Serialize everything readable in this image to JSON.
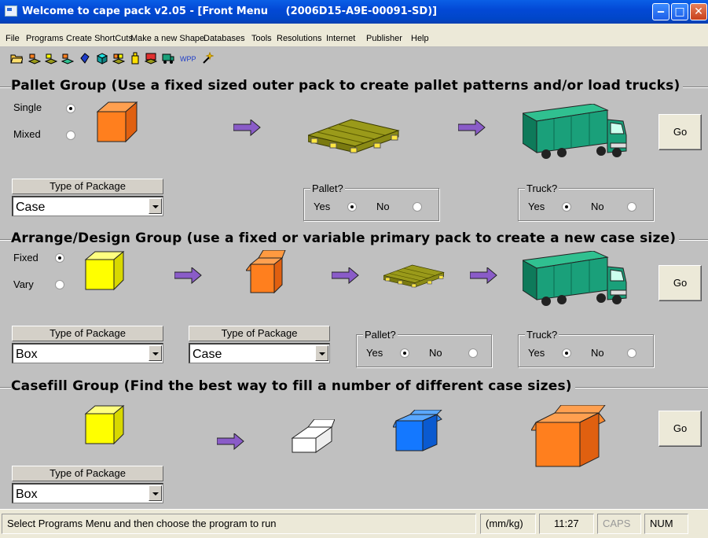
{
  "window": {
    "title": "Welcome to cape pack v2.05 - [Front Menu     (2006D15-A9E-00091-SD)]",
    "buttons": [
      "minimize-icon",
      "maximize-icon",
      "close-icon"
    ]
  },
  "menu": [
    "File",
    "Programs",
    "Create ShortCuts",
    "Make a new Shape",
    "Databases",
    "Tools",
    "Resolutions",
    "Internet",
    "Publisher",
    "Help"
  ],
  "toolbar": {
    "icons": [
      "open-folder-icon",
      "pallet-tool-icon",
      "arrange-tool-icon",
      "design-tool-icon",
      "casefill-tool-icon",
      "cube-tool-icon",
      "mixed-tool-icon",
      "bottle-tool-icon",
      "pallet-view-icon",
      "truck-tool-icon",
      "wpp-icon",
      "wand-icon"
    ],
    "wpp_label": "WPP"
  },
  "pallet_group": {
    "title": "Pallet Group (Use a fixed sized outer pack to create pallet patterns and/or load trucks)",
    "single_label": "Single",
    "mixed_label": "Mixed",
    "selected": "Single",
    "package": {
      "header": "Type of Package",
      "value": "Case"
    },
    "pallet": {
      "legend": "Pallet?",
      "yes": "Yes",
      "no": "No",
      "selected": "Yes"
    },
    "truck": {
      "legend": "Truck?",
      "yes": "Yes",
      "no": "No",
      "selected": "Yes"
    },
    "go": "Go"
  },
  "arrange_group": {
    "title": "Arrange/Design Group (use a fixed or variable primary pack to create a new case size)",
    "fixed_label": "Fixed",
    "vary_label": "Vary",
    "selected": "Fixed",
    "package1": {
      "header": "Type of Package",
      "value": "Box"
    },
    "package2": {
      "header": "Type of Package",
      "value": "Case"
    },
    "pallet": {
      "legend": "Pallet?",
      "yes": "Yes",
      "no": "No",
      "selected": "Yes"
    },
    "truck": {
      "legend": "Truck?",
      "yes": "Yes",
      "no": "No",
      "selected": "Yes"
    },
    "go": "Go"
  },
  "casefill_group": {
    "title": "Casefill Group (Find the best way to fill a number of different case sizes)",
    "package": {
      "header": "Type of Package",
      "value": "Box"
    },
    "go": "Go"
  },
  "status": {
    "message": "Select Programs Menu and then choose the program to run",
    "units": "(mm/kg)",
    "time": "11:27",
    "caps": "CAPS",
    "num": "NUM"
  },
  "colors": {
    "titlebar": "#0349d6",
    "panel": "#c0c0c0",
    "case_orange": "#ff7f1e",
    "box_yellow": "#ffff00",
    "pallet_olive": "#9a9a1a",
    "truck_green": "#1aa07a",
    "arrow_purple": "#8a5cc8",
    "blue_box": "#1478ff"
  }
}
